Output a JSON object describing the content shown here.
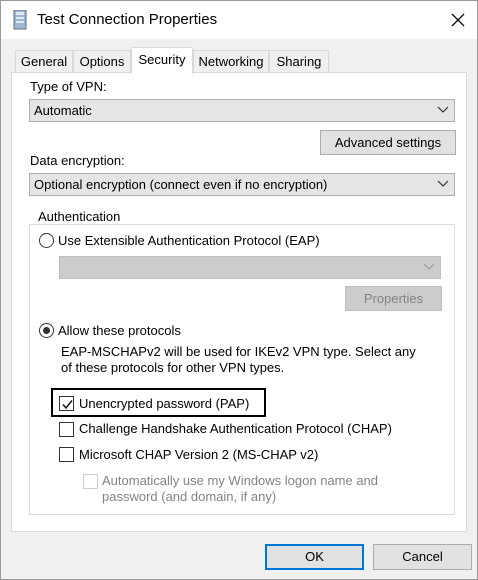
{
  "window": {
    "title": "Test Connection Properties",
    "close_glyph": "✕"
  },
  "tabs": [
    {
      "label": "General"
    },
    {
      "label": "Options"
    },
    {
      "label": "Security"
    },
    {
      "label": "Networking"
    },
    {
      "label": "Sharing"
    }
  ],
  "vpn_type": {
    "label": "Type of VPN:",
    "selected": "Automatic"
  },
  "advanced_settings_label": "Advanced settings",
  "encryption": {
    "label": "Data encryption:",
    "selected": "Optional encryption (connect even if no encryption)"
  },
  "auth": {
    "group_title": "Authentication",
    "eap_label": "Use Extensible Authentication Protocol (EAP)",
    "eap_selected": false,
    "eap_combo_value": "",
    "properties_label": "Properties",
    "allow_label": "Allow these protocols",
    "allow_selected": true,
    "allow_note_line1": "EAP-MSCHAPv2 will be used for IKEv2 VPN type. Select any",
    "allow_note_line2": "of these protocols for other VPN types.",
    "protocols": [
      {
        "label": "Unencrypted password (PAP)",
        "checked": true
      },
      {
        "label": "Challenge Handshake Authentication Protocol (CHAP)",
        "checked": false
      },
      {
        "label": "Microsoft CHAP Version 2 (MS-CHAP v2)",
        "checked": false
      }
    ],
    "auto_logon_line1": "Automatically use my Windows logon name and",
    "auto_logon_line2": "password (and domain, if any)",
    "auto_logon_checked": false
  },
  "footer": {
    "ok_label": "OK",
    "cancel_label": "Cancel"
  },
  "colors": {
    "accent": "#0078d7",
    "panel": "#ffffff",
    "chrome": "#f0f0f0"
  }
}
